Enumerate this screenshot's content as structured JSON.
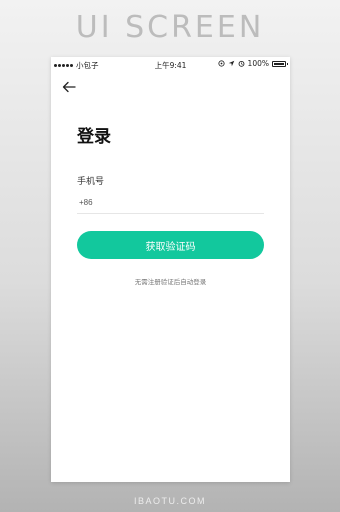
{
  "banner": {
    "text": "UI SCREEN"
  },
  "status_bar": {
    "carrier": "小包子",
    "time": "上午9:41",
    "battery_text": "100%",
    "battery_level": 1.0
  },
  "login": {
    "title": "登录",
    "phone_label": "手机号",
    "country_code": "+86",
    "phone_value": "",
    "phone_placeholder": "",
    "get_code_button": "获取验证码",
    "hint": "无需注册验证后自动登录",
    "accent_color": "#12c89d"
  },
  "icons": {
    "back": "arrow-left-icon",
    "location": "location-arrow-icon",
    "alarm": "alarm-clock-icon",
    "lock": "rotation-lock-icon",
    "battery": "battery-icon"
  },
  "watermark": {
    "text": "IBAOTU.COM"
  }
}
